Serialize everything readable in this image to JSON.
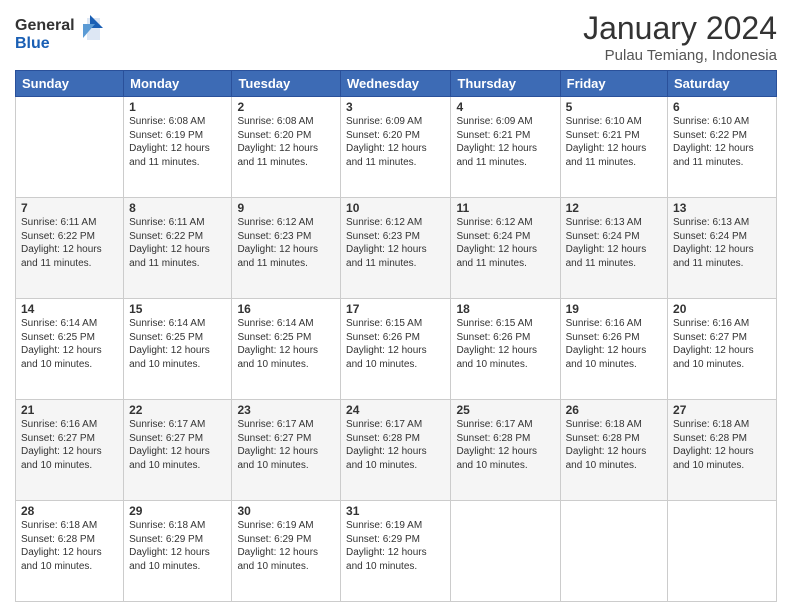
{
  "logo": {
    "line1": "General",
    "line2": "Blue"
  },
  "title": "January 2024",
  "location": "Pulau Temiang, Indonesia",
  "header_days": [
    "Sunday",
    "Monday",
    "Tuesday",
    "Wednesday",
    "Thursday",
    "Friday",
    "Saturday"
  ],
  "weeks": [
    [
      {
        "day": "",
        "info": ""
      },
      {
        "day": "1",
        "info": "Sunrise: 6:08 AM\nSunset: 6:19 PM\nDaylight: 12 hours\nand 11 minutes."
      },
      {
        "day": "2",
        "info": "Sunrise: 6:08 AM\nSunset: 6:20 PM\nDaylight: 12 hours\nand 11 minutes."
      },
      {
        "day": "3",
        "info": "Sunrise: 6:09 AM\nSunset: 6:20 PM\nDaylight: 12 hours\nand 11 minutes."
      },
      {
        "day": "4",
        "info": "Sunrise: 6:09 AM\nSunset: 6:21 PM\nDaylight: 12 hours\nand 11 minutes."
      },
      {
        "day": "5",
        "info": "Sunrise: 6:10 AM\nSunset: 6:21 PM\nDaylight: 12 hours\nand 11 minutes."
      },
      {
        "day": "6",
        "info": "Sunrise: 6:10 AM\nSunset: 6:22 PM\nDaylight: 12 hours\nand 11 minutes."
      }
    ],
    [
      {
        "day": "7",
        "info": ""
      },
      {
        "day": "8",
        "info": "Sunrise: 6:11 AM\nSunset: 6:22 PM\nDaylight: 12 hours\nand 11 minutes."
      },
      {
        "day": "9",
        "info": "Sunrise: 6:12 AM\nSunset: 6:23 PM\nDaylight: 12 hours\nand 11 minutes."
      },
      {
        "day": "10",
        "info": "Sunrise: 6:12 AM\nSunset: 6:23 PM\nDaylight: 12 hours\nand 11 minutes."
      },
      {
        "day": "11",
        "info": "Sunrise: 6:12 AM\nSunset: 6:24 PM\nDaylight: 12 hours\nand 11 minutes."
      },
      {
        "day": "12",
        "info": "Sunrise: 6:13 AM\nSunset: 6:24 PM\nDaylight: 12 hours\nand 11 minutes."
      },
      {
        "day": "13",
        "info": "Sunrise: 6:13 AM\nSunset: 6:24 PM\nDaylight: 12 hours\nand 11 minutes."
      }
    ],
    [
      {
        "day": "14",
        "info": ""
      },
      {
        "day": "15",
        "info": "Sunrise: 6:14 AM\nSunset: 6:25 PM\nDaylight: 12 hours\nand 10 minutes."
      },
      {
        "day": "16",
        "info": "Sunrise: 6:14 AM\nSunset: 6:25 PM\nDaylight: 12 hours\nand 10 minutes."
      },
      {
        "day": "17",
        "info": "Sunrise: 6:15 AM\nSunset: 6:26 PM\nDaylight: 12 hours\nand 10 minutes."
      },
      {
        "day": "18",
        "info": "Sunrise: 6:15 AM\nSunset: 6:26 PM\nDaylight: 12 hours\nand 10 minutes."
      },
      {
        "day": "19",
        "info": "Sunrise: 6:16 AM\nSunset: 6:26 PM\nDaylight: 12 hours\nand 10 minutes."
      },
      {
        "day": "20",
        "info": "Sunrise: 6:16 AM\nSunset: 6:27 PM\nDaylight: 12 hours\nand 10 minutes."
      }
    ],
    [
      {
        "day": "21",
        "info": ""
      },
      {
        "day": "22",
        "info": "Sunrise: 6:17 AM\nSunset: 6:27 PM\nDaylight: 12 hours\nand 10 minutes."
      },
      {
        "day": "23",
        "info": "Sunrise: 6:17 AM\nSunset: 6:27 PM\nDaylight: 12 hours\nand 10 minutes."
      },
      {
        "day": "24",
        "info": "Sunrise: 6:17 AM\nSunset: 6:28 PM\nDaylight: 12 hours\nand 10 minutes."
      },
      {
        "day": "25",
        "info": "Sunrise: 6:17 AM\nSunset: 6:28 PM\nDaylight: 12 hours\nand 10 minutes."
      },
      {
        "day": "26",
        "info": "Sunrise: 6:18 AM\nSunset: 6:28 PM\nDaylight: 12 hours\nand 10 minutes."
      },
      {
        "day": "27",
        "info": "Sunrise: 6:18 AM\nSunset: 6:28 PM\nDaylight: 12 hours\nand 10 minutes."
      }
    ],
    [
      {
        "day": "28",
        "info": "Sunrise: 6:18 AM\nSunset: 6:28 PM\nDaylight: 12 hours\nand 10 minutes."
      },
      {
        "day": "29",
        "info": "Sunrise: 6:18 AM\nSunset: 6:29 PM\nDaylight: 12 hours\nand 10 minutes."
      },
      {
        "day": "30",
        "info": "Sunrise: 6:19 AM\nSunset: 6:29 PM\nDaylight: 12 hours\nand 10 minutes."
      },
      {
        "day": "31",
        "info": "Sunrise: 6:19 AM\nSunset: 6:29 PM\nDaylight: 12 hours\nand 10 minutes."
      },
      {
        "day": "",
        "info": ""
      },
      {
        "day": "",
        "info": ""
      },
      {
        "day": "",
        "info": ""
      }
    ]
  ],
  "week7_sunday_info": "Sunrise: 6:11 AM\nSunset: 6:22 PM\nDaylight: 12 hours\nand 11 minutes.",
  "week14_sunday_info": "Sunrise: 6:14 AM\nSunset: 6:25 PM\nDaylight: 12 hours\nand 10 minutes.",
  "week21_sunday_info": "Sunrise: 6:16 AM\nSunset: 6:27 PM\nDaylight: 12 hours\nand 10 minutes."
}
